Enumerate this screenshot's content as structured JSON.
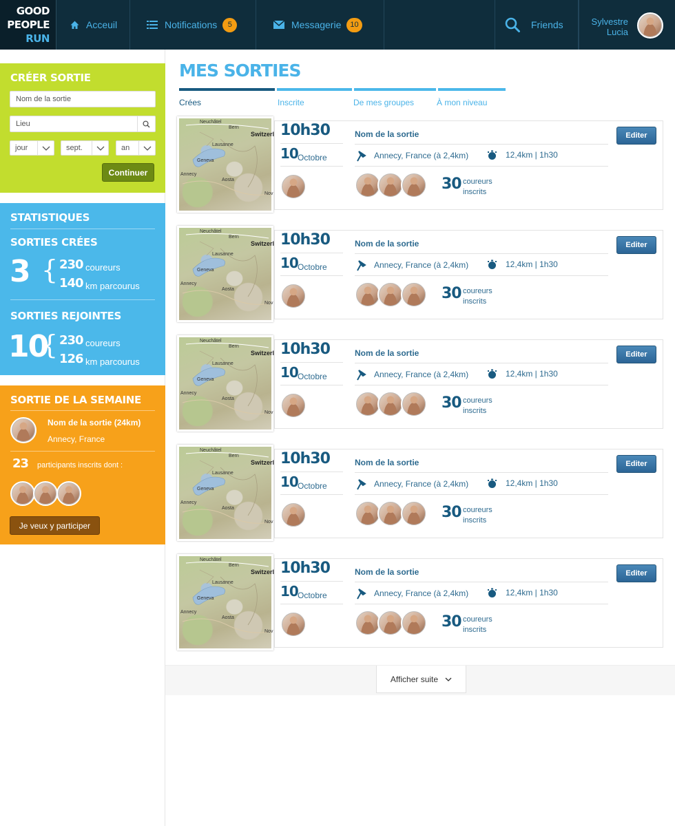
{
  "brand": {
    "line1": "GOOD",
    "line2": "PEOPLE",
    "line3": "RUN",
    "accent": "#4ab3e8"
  },
  "nav": {
    "home": {
      "label": "Acceuil",
      "icon": "home-icon"
    },
    "notifications": {
      "label": "Notifications",
      "count": "5",
      "icon": "list-icon"
    },
    "messages": {
      "label": "Messagerie",
      "count": "10",
      "icon": "envelope-icon"
    },
    "friends": {
      "label": "Friends",
      "icon": "search-icon"
    },
    "user": {
      "first": "Sylvestre",
      "last": "Lucia"
    }
  },
  "create": {
    "title": "CRÉER SORTIE",
    "name_placeholder": "Nom de la sortie",
    "place_placeholder": "Lieu",
    "day": "jour",
    "month": "sept.",
    "year": "an",
    "submit": "Continuer"
  },
  "stats": {
    "title": "STATISTIQUES",
    "created": {
      "title": "SORTIES CRÉES",
      "count": "3",
      "runners": "230",
      "runners_label": "coureurs",
      "km": "140",
      "km_label": "km parcourus"
    },
    "joined": {
      "title": "SORTIES REJOINTES",
      "count": "10",
      "runners": "230",
      "runners_label": "coureurs",
      "km": "126",
      "km_label": "km parcourus"
    }
  },
  "week": {
    "title": "SORTIE DE LA SEMAINE",
    "name": "Nom de la sortie (24km)",
    "place": "Annecy, France",
    "count": "23",
    "count_label": "participants inscrits dont :",
    "cta": "Je veux y participer"
  },
  "main": {
    "title": "MES SORTIES",
    "tabs": [
      {
        "label": "Crées",
        "active": true
      },
      {
        "label": "Inscrite",
        "active": false
      },
      {
        "label": "De mes groupes",
        "active": false
      },
      {
        "label": "À mon niveau",
        "active": false
      }
    ],
    "map_labels": {
      "a": "Neuchâtel",
      "b": "Bern",
      "c": "Switzerl",
      "d": "Lausanne",
      "e": "Geneva",
      "f": "Annecy",
      "g": "Aosta",
      "h": "Nov"
    },
    "runs": [
      {
        "time": "10h30",
        "day": "10",
        "month": "Octobre",
        "name": "Nom de la sortie",
        "place": "Annecy, France (à 2,4km)",
        "distance": "12,4km | 1h30",
        "count": "30",
        "count_label1": "coureurs",
        "count_label2": "inscrits",
        "edit": "Editer"
      },
      {
        "time": "10h30",
        "day": "10",
        "month": "Octobre",
        "name": "Nom de la sortie",
        "place": "Annecy, France (à 2,4km)",
        "distance": "12,4km | 1h30",
        "count": "30",
        "count_label1": "coureurs",
        "count_label2": "inscrits",
        "edit": "Editer"
      },
      {
        "time": "10h30",
        "day": "10",
        "month": "Octobre",
        "name": "Nom de la sortie",
        "place": "Annecy, France (à 2,4km)",
        "distance": "12,4km | 1h30",
        "count": "30",
        "count_label1": "coureurs",
        "count_label2": "inscrits",
        "edit": "Editer"
      },
      {
        "time": "10h30",
        "day": "10",
        "month": "Octobre",
        "name": "Nom de la sortie",
        "place": "Annecy, France (à 2,4km)",
        "distance": "12,4km | 1h30",
        "count": "30",
        "count_label1": "coureurs",
        "count_label2": "inscrits",
        "edit": "Editer"
      },
      {
        "time": "10h30",
        "day": "10",
        "month": "Octobre",
        "name": "Nom de la sortie",
        "place": "Annecy, France (à 2,4km)",
        "distance": "12,4km | 1h30",
        "count": "30",
        "count_label1": "coureurs",
        "count_label2": "inscrits",
        "edit": "Editer"
      }
    ],
    "more": "Afficher suite"
  }
}
